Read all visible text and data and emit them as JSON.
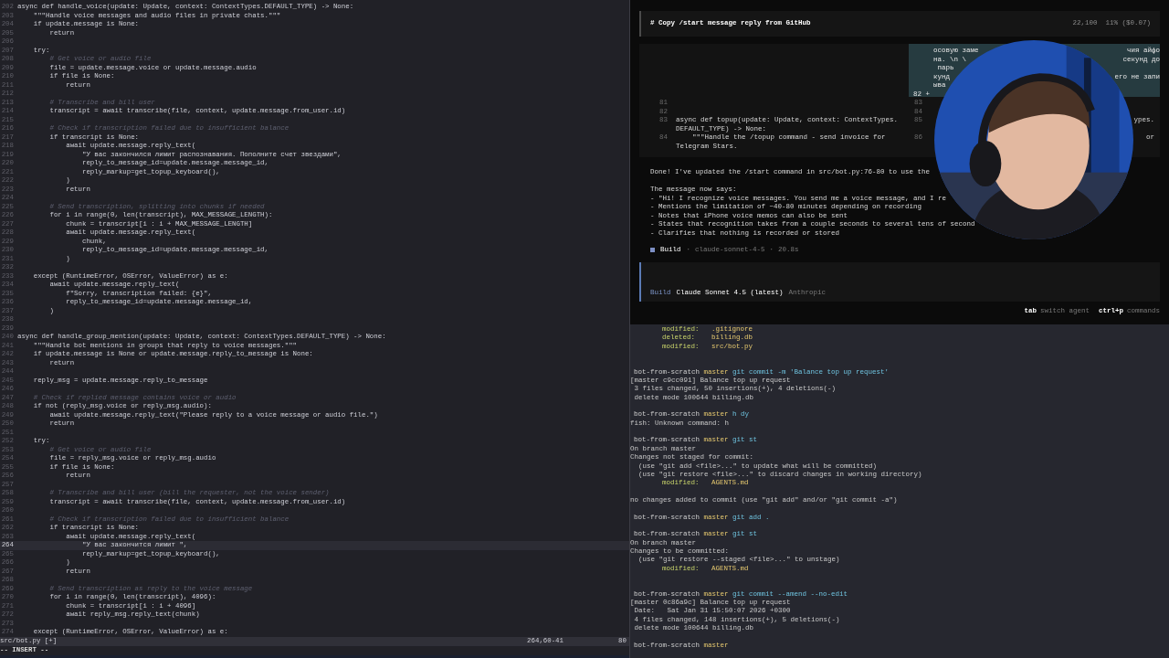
{
  "editor": {
    "lines": [
      {
        "num": "202",
        "text": "async def handle_voice(update: Update, context: ContextTypes.DEFAULT_TYPE) -> None:",
        "kind": "code",
        "selected": false
      },
      {
        "num": "203",
        "text": "    \"\"\"Handle voice messages and audio files in private chats.\"\"\"",
        "kind": "code",
        "selected": false
      },
      {
        "num": "204",
        "text": "    if update.message is None:",
        "kind": "code",
        "selected": false
      },
      {
        "num": "205",
        "text": "        return",
        "kind": "code",
        "selected": false
      },
      {
        "num": "206",
        "kind": "code",
        "selected": false
      },
      {
        "num": "207",
        "text": "    try:",
        "kind": "code",
        "selected": false
      },
      {
        "num": "208",
        "text": "        # Get voice or audio file",
        "kind": "comment",
        "selected": false
      },
      {
        "num": "209",
        "text": "        file = update.message.voice or update.message.audio",
        "kind": "code",
        "selected": false
      },
      {
        "num": "210",
        "text": "        if file is None:",
        "kind": "code",
        "selected": false
      },
      {
        "num": "211",
        "text": "            return",
        "kind": "code",
        "selected": false
      },
      {
        "num": "212",
        "kind": "code",
        "selected": false
      },
      {
        "num": "213",
        "text": "        # Transcribe and bill user",
        "kind": "comment",
        "selected": false
      },
      {
        "num": "214",
        "text": "        transcript = await transcribe(file, context, update.message.from_user.id)",
        "kind": "code",
        "selected": false
      },
      {
        "num": "215",
        "kind": "code",
        "selected": false
      },
      {
        "num": "216",
        "text": "        # Check if transcription failed due to insufficient balance",
        "kind": "comment",
        "selected": false
      },
      {
        "num": "217",
        "text": "        if transcript is None:",
        "kind": "code",
        "selected": false
      },
      {
        "num": "218",
        "text": "            await update.message.reply_text(",
        "kind": "code",
        "selected": false
      },
      {
        "num": "219",
        "text": "                \"У вас закончился лимит распознавания. Пополните счет звездами\",",
        "kind": "code",
        "selected": false
      },
      {
        "num": "220",
        "text": "                reply_to_message_id=update.message.message_id,",
        "kind": "code",
        "selected": false
      },
      {
        "num": "221",
        "text": "                reply_markup=get_topup_keyboard(),",
        "kind": "code",
        "selected": false
      },
      {
        "num": "222",
        "text": "            )",
        "kind": "code",
        "selected": false
      },
      {
        "num": "223",
        "text": "            return",
        "kind": "code",
        "selected": false
      },
      {
        "num": "224",
        "kind": "code",
        "selected": false
      },
      {
        "num": "225",
        "text": "        # Send transcription, splitting into chunks if needed",
        "kind": "comment",
        "selected": false
      },
      {
        "num": "226",
        "text": "        for i in range(0, len(transcript), MAX_MESSAGE_LENGTH):",
        "kind": "code",
        "selected": false
      },
      {
        "num": "227",
        "text": "            chunk = transcript[i : i + MAX_MESSAGE_LENGTH]",
        "kind": "code",
        "selected": false
      },
      {
        "num": "228",
        "text": "            await update.message.reply_text(",
        "kind": "code",
        "selected": false
      },
      {
        "num": "229",
        "text": "                chunk,",
        "kind": "code",
        "selected": false
      },
      {
        "num": "230",
        "text": "                reply_to_message_id=update.message.message_id,",
        "kind": "code",
        "selected": false
      },
      {
        "num": "231",
        "text": "            )",
        "kind": "code",
        "selected": false
      },
      {
        "num": "232",
        "kind": "code",
        "selected": false
      },
      {
        "num": "233",
        "text": "    except (RuntimeError, OSError, ValueError) as e:",
        "kind": "code",
        "selected": false
      },
      {
        "num": "234",
        "text": "        await update.message.reply_text(",
        "kind": "code",
        "selected": false
      },
      {
        "num": "235",
        "text": "            f\"Sorry, transcription failed: {e}\",",
        "kind": "code",
        "selected": false
      },
      {
        "num": "236",
        "text": "            reply_to_message_id=update.message.message_id,",
        "kind": "code",
        "selected": false
      },
      {
        "num": "237",
        "text": "        )",
        "kind": "code",
        "selected": false
      },
      {
        "num": "238",
        "kind": "code",
        "selected": false
      },
      {
        "num": "239",
        "kind": "code",
        "selected": false
      },
      {
        "num": "240",
        "text": "async def handle_group_mention(update: Update, context: ContextTypes.DEFAULT_TYPE) -> None:",
        "kind": "code",
        "selected": false
      },
      {
        "num": "241",
        "text": "    \"\"\"Handle bot mentions in groups that reply to voice messages.\"\"\"",
        "kind": "code",
        "selected": false
      },
      {
        "num": "242",
        "text": "    if update.message is None or update.message.reply_to_message is None:",
        "kind": "code",
        "selected": false
      },
      {
        "num": "243",
        "text": "        return",
        "kind": "code",
        "selected": false
      },
      {
        "num": "244",
        "kind": "code",
        "selected": false
      },
      {
        "num": "245",
        "text": "    reply_msg = update.message.reply_to_message",
        "kind": "code",
        "selected": false
      },
      {
        "num": "246",
        "kind": "code",
        "selected": false
      },
      {
        "num": "247",
        "text": "    # Check if replied message contains voice or audio",
        "kind": "comment",
        "selected": false
      },
      {
        "num": "248",
        "text": "    if not (reply_msg.voice or reply_msg.audio):",
        "kind": "code",
        "selected": false
      },
      {
        "num": "249",
        "text": "        await update.message.reply_text(\"Please reply to a voice message or audio file.\")",
        "kind": "code",
        "selected": false
      },
      {
        "num": "250",
        "text": "        return",
        "kind": "code",
        "selected": false
      },
      {
        "num": "251",
        "kind": "code",
        "selected": false
      },
      {
        "num": "252",
        "text": "    try:",
        "kind": "code",
        "selected": false
      },
      {
        "num": "253",
        "text": "        # Get voice or audio file",
        "kind": "comment",
        "selected": false
      },
      {
        "num": "254",
        "text": "        file = reply_msg.voice or reply_msg.audio",
        "kind": "code",
        "selected": false
      },
      {
        "num": "255",
        "text": "        if file is None:",
        "kind": "code",
        "selected": false
      },
      {
        "num": "256",
        "text": "            return",
        "kind": "code",
        "selected": false
      },
      {
        "num": "257",
        "kind": "code",
        "selected": false
      },
      {
        "num": "258",
        "text": "        # Transcribe and bill user (bill the requester, not the voice sender)",
        "kind": "comment",
        "selected": false
      },
      {
        "num": "259",
        "text": "        transcript = await transcribe(file, context, update.message.from_user.id)",
        "kind": "code",
        "selected": false
      },
      {
        "num": "260",
        "kind": "code",
        "selected": false
      },
      {
        "num": "261",
        "text": "        # Check if transcription failed due to insufficient balance",
        "kind": "comment",
        "selected": false
      },
      {
        "num": "262",
        "text": "        if transcript is None:",
        "kind": "code",
        "selected": false
      },
      {
        "num": "263",
        "text": "            await update.message.reply_text(",
        "kind": "code",
        "selected": false
      },
      {
        "num": "264",
        "text": "                \"У вас закончится лимит \",",
        "kind": "code",
        "selected": true
      },
      {
        "num": "265",
        "text": "                reply_markup=get_topup_keyboard(),",
        "kind": "code",
        "selected": false
      },
      {
        "num": "266",
        "text": "            )",
        "kind": "code",
        "selected": false
      },
      {
        "num": "267",
        "text": "            return",
        "kind": "code",
        "selected": false
      },
      {
        "num": "268",
        "kind": "code",
        "selected": false
      },
      {
        "num": "269",
        "text": "        # Send transcription as reply to the voice message",
        "kind": "comment",
        "selected": false
      },
      {
        "num": "270",
        "text": "        for i in range(0, len(transcript), 4096):",
        "kind": "code",
        "selected": false
      },
      {
        "num": "271",
        "text": "            chunk = transcript[i : i + 4096]",
        "kind": "code",
        "selected": false
      },
      {
        "num": "272",
        "text": "            await reply_msg.reply_text(chunk)",
        "kind": "code",
        "selected": false
      },
      {
        "num": "273",
        "kind": "code",
        "selected": false
      },
      {
        "num": "274",
        "text": "    except (RuntimeError, OSError, ValueError) as e:",
        "kind": "code",
        "selected": false
      }
    ],
    "status_bar": {
      "file": "src/bot.py [+]",
      "position": "264,60-41",
      "percent": "80"
    },
    "mode": "-- INSERT --"
  },
  "agent": {
    "header": {
      "title": "# Copy /start message reply from GitHub",
      "stats": "22,100  11% ($0.07)"
    },
    "diff": {
      "left": [
        {
          "num": "81"
        },
        {
          "num": "82"
        },
        {
          "num": "83",
          "text": "async def topup(update: Update, context: ContextTypes."
        },
        {
          "text": "DEFAULT_TYPE) -> None:"
        },
        {
          "num": "84",
          "text": "    \"\"\"Handle the /topup command - send invoice for"
        },
        {
          "text": "Telegram Stars."
        }
      ],
      "added": [
        {
          "left": "осовую заме",
          "right": "чия айфо"
        },
        {
          "left": "на. \\n \\",
          "right": "секунд до"
        },
        {
          "left": " парь"
        },
        {
          "left": "кунд",
          "right": "его не запи"
        },
        {
          "left": "ыва"
        },
        {
          "num": "82 +"
        }
      ],
      "right": [
        {
          "num": "83",
          "wrapped": false
        },
        {
          "num": "84",
          "wrapped": false
        },
        {
          "num": "85",
          "tail": "ypes.",
          "wrapped": true
        },
        {
          "num": "86",
          "tail": "or",
          "wrapped": false
        }
      ]
    },
    "message": {
      "lead": "Done! I've updated the /start command in src/bot.py:76-80 to use the",
      "heading": "The message now says:",
      "bullets": [
        "- \"Hi! I recognize voice messages. You send me a voice message, and I re",
        "- Mentions the limitation of ~40-80 minutes depending on recording",
        "- Notes that iPhone voice memos can also be sent",
        "- States that recognition takes from a couple seconds to several tens of second",
        "- Clarifies that nothing is recorded or stored"
      ]
    },
    "run": {
      "agent": "Build",
      "separator": "·",
      "model": "claude-sonnet-4-5",
      "time": "20.8s"
    },
    "input": {
      "agent": "Build",
      "model": "Claude Sonnet 4.5 (latest)",
      "provider": "Anthropic"
    },
    "hints": [
      {
        "key": "tab",
        "label": "switch agent"
      },
      {
        "key": "ctrl+p",
        "label": "commands"
      }
    ]
  },
  "terminal": {
    "lines": [
      {
        "kind": "status",
        "label": "modified:",
        "file": ".gitignore"
      },
      {
        "kind": "status",
        "label": "deleted:",
        "file": "billing.db"
      },
      {
        "kind": "status",
        "label": "modified:",
        "file": "src/bot.py"
      },
      {
        "kind": "blank"
      },
      {
        "kind": "blank"
      },
      {
        "kind": "prompt",
        "dir": "bot-from-scratch",
        "branch": "master",
        "cmd": "git commit -m 'Balance top up request'"
      },
      {
        "kind": "out",
        "text": "[master c9cc091] Balance top up request"
      },
      {
        "kind": "out",
        "text": " 3 files changed, 50 insertions(+), 4 deletions(-)"
      },
      {
        "kind": "out",
        "text": " delete mode 100644 billing.db"
      },
      {
        "kind": "blank"
      },
      {
        "kind": "prompt",
        "dir": "bot-from-scratch",
        "branch": "master",
        "cmd": "h dy"
      },
      {
        "kind": "out",
        "text": "fish: Unknown command: h"
      },
      {
        "kind": "blank"
      },
      {
        "kind": "prompt",
        "dir": "bot-from-scratch",
        "branch": "master",
        "cmd": "git st"
      },
      {
        "kind": "out",
        "text": "On branch master"
      },
      {
        "kind": "out",
        "text": "Changes not staged for commit:"
      },
      {
        "kind": "out",
        "text": "  (use \"git add <file>...\" to update what will be committed)"
      },
      {
        "kind": "out",
        "text": "  (use \"git restore <file>...\" to discard changes in working directory)"
      },
      {
        "kind": "status",
        "label": "modified:",
        "file": "AGENTS.md"
      },
      {
        "kind": "blank"
      },
      {
        "kind": "out",
        "text": "no changes added to commit (use \"git add\" and/or \"git commit -a\")"
      },
      {
        "kind": "blank"
      },
      {
        "kind": "prompt",
        "dir": "bot-from-scratch",
        "branch": "master",
        "cmd": "git add ."
      },
      {
        "kind": "blank"
      },
      {
        "kind": "prompt",
        "dir": "bot-from-scratch",
        "branch": "master",
        "cmd": "git st"
      },
      {
        "kind": "out",
        "text": "On branch master"
      },
      {
        "kind": "out",
        "text": "Changes to be committed:"
      },
      {
        "kind": "out",
        "text": "  (use \"git restore --staged <file>...\" to unstage)"
      },
      {
        "kind": "status",
        "label": "modified:",
        "file": "AGENTS.md"
      },
      {
        "kind": "blank"
      },
      {
        "kind": "blank"
      },
      {
        "kind": "prompt",
        "dir": "bot-from-scratch",
        "branch": "master",
        "cmd": "git commit --amend --no-edit"
      },
      {
        "kind": "out",
        "text": "[master 0c86a9c] Balance top up request"
      },
      {
        "kind": "out",
        "text": " Date:   Sat Jan 31 15:50:07 2026 +0300"
      },
      {
        "kind": "out",
        "text": " 4 files changed, 148 insertions(+), 5 deletions(-)"
      },
      {
        "kind": "out",
        "text": " delete mode 100644 billing.db"
      },
      {
        "kind": "blank"
      },
      {
        "kind": "prompt",
        "dir": "bot-from-scratch",
        "branch": "master"
      }
    ]
  }
}
